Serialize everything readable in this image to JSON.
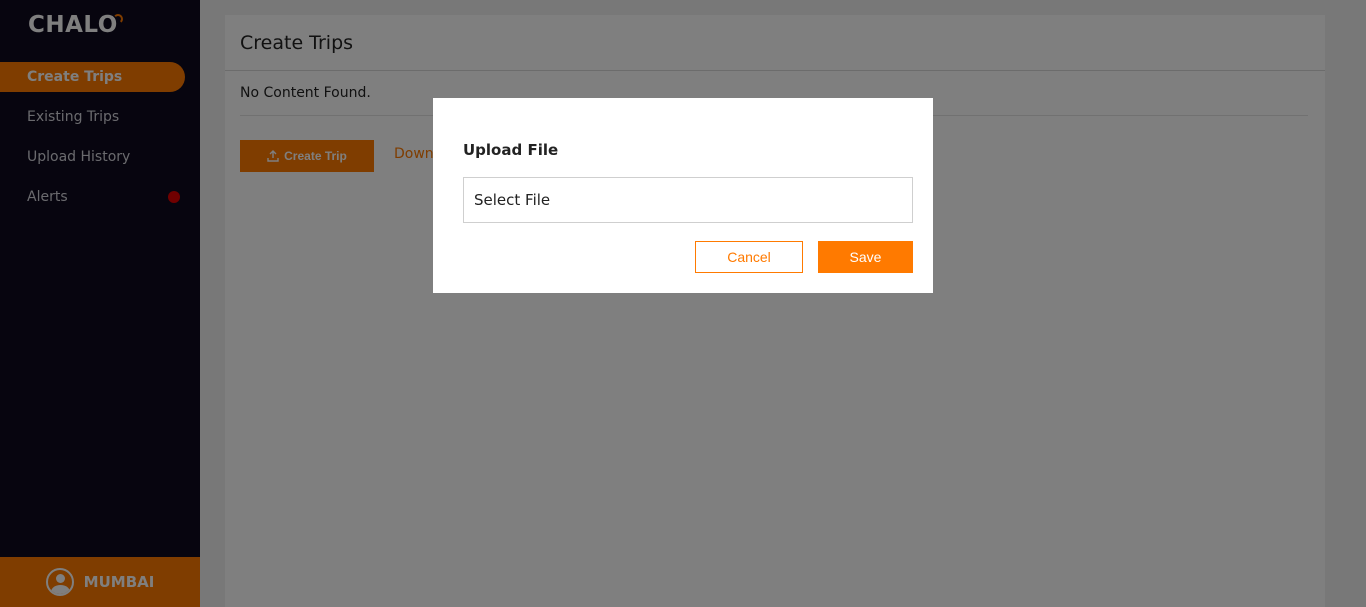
{
  "brand": {
    "logo_text": "CHALO",
    "accent_color": "#ff7a00",
    "sidebar_bg": "#0f0b1e"
  },
  "sidebar": {
    "items": [
      {
        "label": "Create Trips",
        "active": true
      },
      {
        "label": "Existing Trips",
        "active": false
      },
      {
        "label": "Upload History",
        "active": false
      },
      {
        "label": "Alerts",
        "active": false,
        "badge": "red-dot"
      }
    ],
    "user": {
      "icon": "user-icon",
      "city": "MUMBAI"
    }
  },
  "main": {
    "title": "Create Trips",
    "empty_message": "No Content Found.",
    "create_button_label": "Create Trip",
    "create_button_icon": "upload-icon",
    "download_link_label": "Down"
  },
  "modal": {
    "title": "Upload File",
    "file_input_label": "Select File",
    "cancel_label": "Cancel",
    "save_label": "Save"
  }
}
